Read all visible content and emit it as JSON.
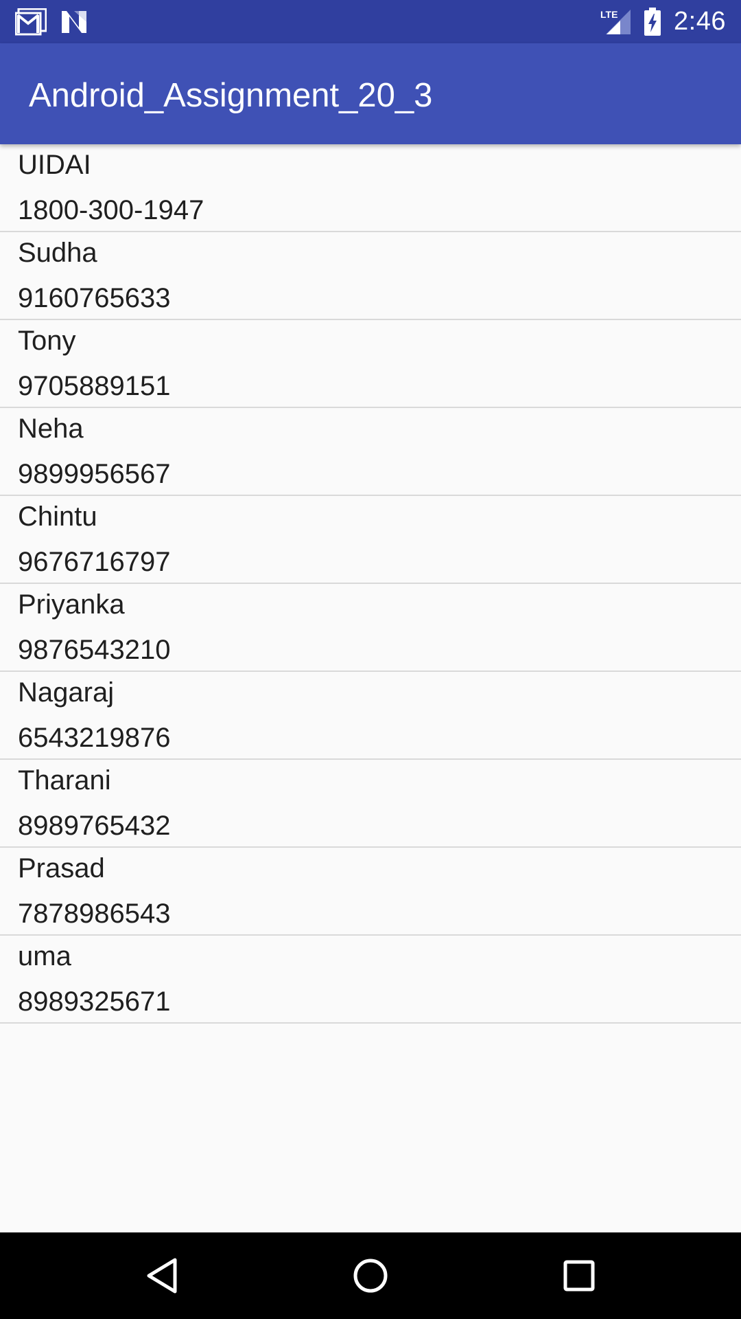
{
  "status_bar": {
    "time": "2:46",
    "network": "LTE",
    "icons": [
      "gmail-icon",
      "n-notification-icon",
      "lte-signal-icon",
      "battery-charging-icon"
    ]
  },
  "app_bar": {
    "title": "Android_Assignment_20_3"
  },
  "contacts": [
    {
      "name": "UIDAI",
      "phone": "1800-300-1947"
    },
    {
      "name": "Sudha",
      "phone": "9160765633"
    },
    {
      "name": "Tony",
      "phone": "9705889151"
    },
    {
      "name": "Neha",
      "phone": "9899956567"
    },
    {
      "name": "Chintu",
      "phone": "9676716797"
    },
    {
      "name": "Priyanka",
      "phone": "9876543210"
    },
    {
      "name": "Nagaraj",
      "phone": "6543219876"
    },
    {
      "name": "Tharani",
      "phone": "8989765432"
    },
    {
      "name": "Prasad",
      "phone": "7878986543"
    },
    {
      "name": "uma",
      "phone": "8989325671"
    }
  ],
  "nav_bar": {
    "buttons": [
      "back-icon",
      "home-icon",
      "recents-icon"
    ]
  },
  "colors": {
    "status_bar": "#303f9f",
    "app_bar": "#3f51b5",
    "background": "#fafafa",
    "divider": "#d9d9d9",
    "text": "#1f1f1f"
  }
}
